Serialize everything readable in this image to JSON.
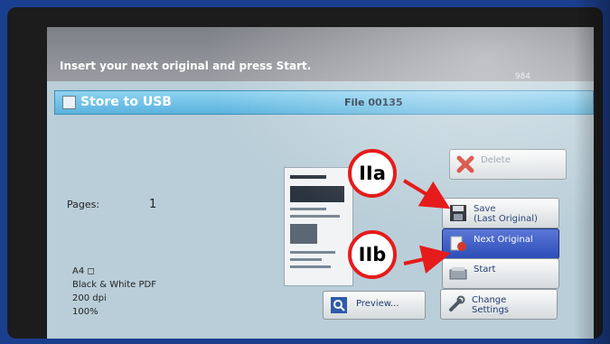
{
  "screen": {
    "message": "Insert your next original and press Start.",
    "corner_text": "984"
  },
  "title_bar": {
    "app_title": "Store to USB",
    "file_name": "File 00135"
  },
  "job": {
    "pages_label": "Pages:",
    "pages_value": "1",
    "paper": "A4 ◻",
    "mode": "Black & White  PDF",
    "resolution": "200 dpi",
    "zoom": "100%"
  },
  "buttons": {
    "delete": "Delete",
    "save_line1": "Save",
    "save_line2": "(Last Original)",
    "next_original": "Next Original",
    "start": "Start",
    "change_line1": "Change",
    "change_line2": "Settings",
    "preview": "Preview..."
  },
  "annotations": {
    "callout_a": "IIa",
    "callout_b": "IIb",
    "color": "#e61b1b"
  },
  "icons": [
    "app-icon",
    "delete-x-icon",
    "floppy-disk-icon",
    "next-page-icon",
    "scanner-icon",
    "wrench-settings-icon",
    "magnifier-icon"
  ]
}
